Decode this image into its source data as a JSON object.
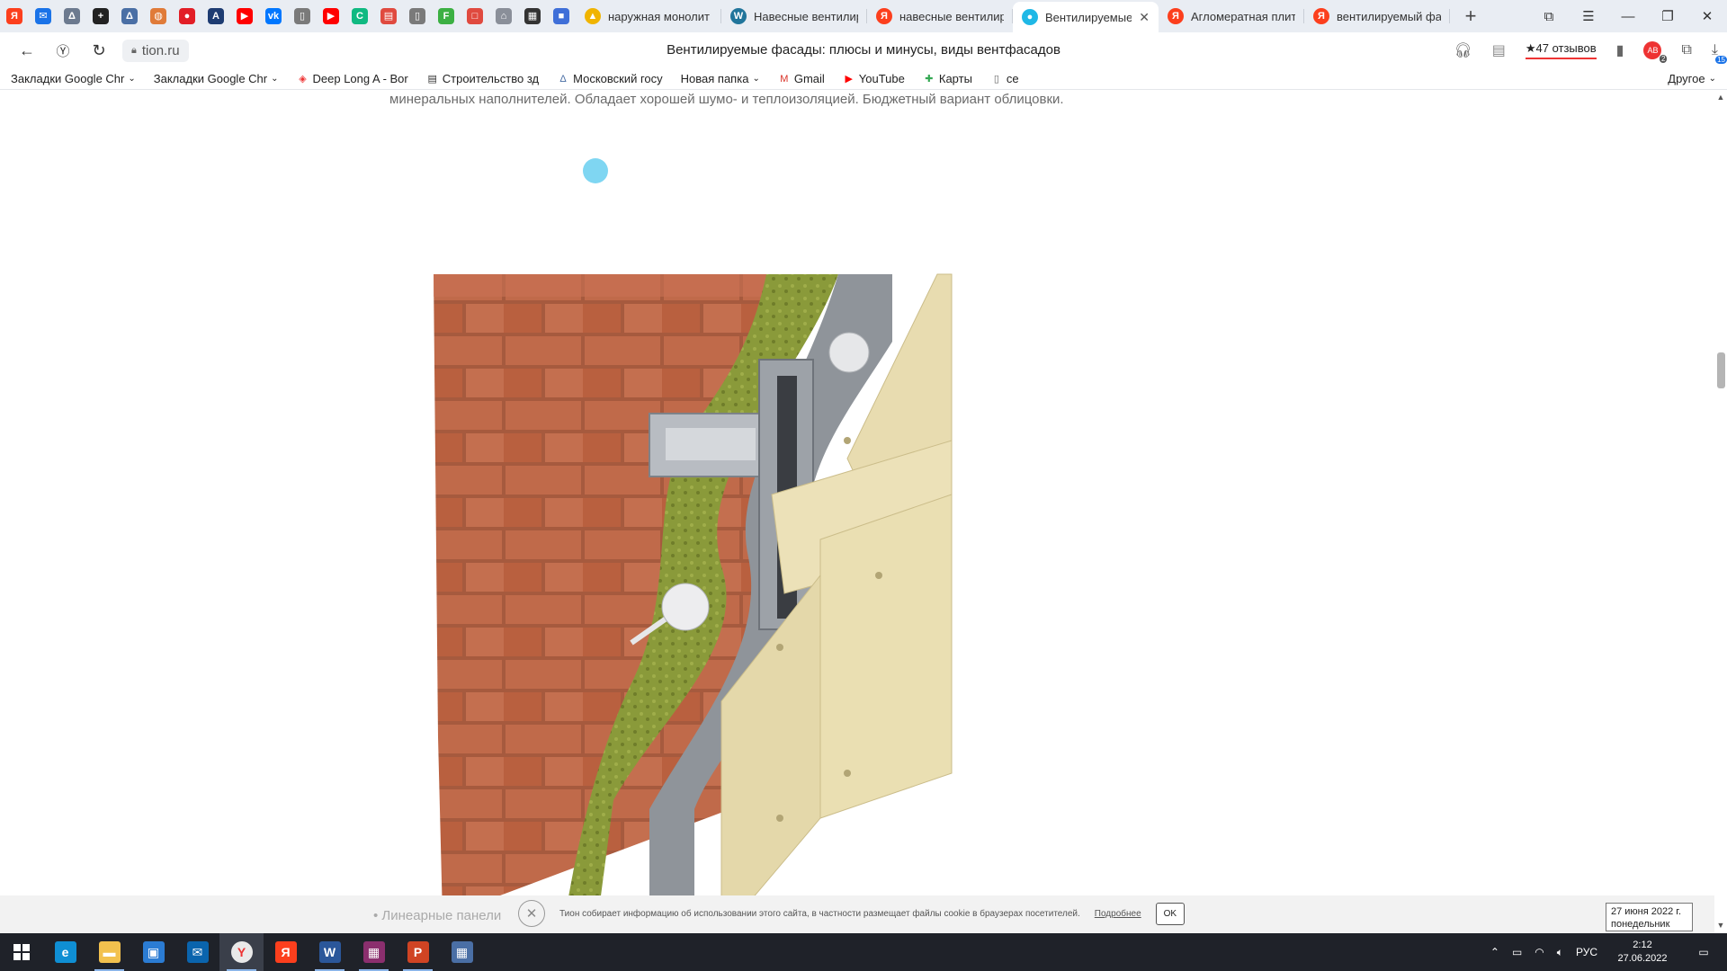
{
  "browser": {
    "pinned_tabs": [
      {
        "icon": "yandex-icon",
        "color": "#fc3f1d",
        "glyph": "Я"
      },
      {
        "icon": "mail-icon",
        "color": "#1a73e8",
        "glyph": "✉"
      },
      {
        "icon": "tower-icon",
        "color": "#6c7a8f",
        "glyph": "Δ"
      },
      {
        "icon": "plus-cross-icon",
        "color": "#222222",
        "glyph": "+"
      },
      {
        "icon": "tower-icon",
        "color": "#4a6fa5",
        "glyph": "Δ"
      },
      {
        "icon": "map-icon",
        "color": "#e07b39",
        "glyph": "◍"
      },
      {
        "icon": "drop-icon",
        "color": "#e21e26",
        "glyph": "●"
      },
      {
        "icon": "letter-a-icon",
        "color": "#1e3c72",
        "glyph": "A"
      },
      {
        "icon": "youtube-icon",
        "color": "#ff0000",
        "glyph": "▶"
      },
      {
        "icon": "vk-icon",
        "color": "#0077ff",
        "glyph": "vk"
      },
      {
        "icon": "document-icon",
        "color": "#7a7a7a",
        "glyph": "▯"
      },
      {
        "icon": "youtube-icon",
        "color": "#ff0000",
        "glyph": "▶"
      },
      {
        "icon": "refresh-green-icon",
        "color": "#10b981",
        "glyph": "C"
      },
      {
        "icon": "pdf-icon",
        "color": "#e04a3f",
        "glyph": "▤"
      },
      {
        "icon": "document-icon",
        "color": "#7a7a7a",
        "glyph": "▯"
      },
      {
        "icon": "letter-f-icon",
        "color": "#3cb043",
        "glyph": "F"
      },
      {
        "icon": "chat-icon",
        "color": "#e04a3f",
        "glyph": "□"
      },
      {
        "icon": "house-icon",
        "color": "#8a8f99",
        "glyph": "⌂"
      },
      {
        "icon": "book-icon",
        "color": "#333333",
        "glyph": "▦"
      },
      {
        "icon": "cube-icon",
        "color": "#3f6fd8",
        "glyph": "■"
      }
    ],
    "tabs": [
      {
        "title": "наружная монолит",
        "icon": "image-icon",
        "color": "#f0b400",
        "glyph": "▲",
        "active": false
      },
      {
        "title": "Навесные вентилир",
        "icon": "wordpress-icon",
        "color": "#21759b",
        "glyph": "W",
        "active": false
      },
      {
        "title": "навесные вентилир",
        "icon": "yandex-icon",
        "color": "#fc3f1d",
        "glyph": "Я",
        "active": false
      },
      {
        "title": "Вентилируемые",
        "icon": "tion-icon",
        "color": "#1fb8e6",
        "glyph": "●",
        "active": true
      },
      {
        "title": "Агломератная плит",
        "icon": "yandex-icon",
        "color": "#fc3f1d",
        "glyph": "Я",
        "active": false
      },
      {
        "title": "вентилируемый фа",
        "icon": "yandex-icon",
        "color": "#fc3f1d",
        "glyph": "Я",
        "active": false
      }
    ],
    "url": "tion.ru",
    "page_title": "Вентилируемые фасады: плюсы и минусы, виды вентфасадов",
    "reviews": "★47 отзывов",
    "extension_badge": "2",
    "downloads_badge": "15"
  },
  "bookmarks": [
    {
      "label": "Закладки Google Chr",
      "icon": "folder-icon",
      "dropdown": true
    },
    {
      "label": "Закладки Google Chr",
      "icon": "folder-icon",
      "dropdown": true
    },
    {
      "label": "Deep Long A - Bor",
      "icon": "deep-long-icon",
      "dropdown": false
    },
    {
      "label": "Строительство зд",
      "icon": "building-icon",
      "dropdown": false
    },
    {
      "label": "Московский госу",
      "icon": "tower-icon",
      "dropdown": false
    },
    {
      "label": "Новая папка",
      "icon": "folder-icon",
      "dropdown": true
    },
    {
      "label": "Gmail",
      "icon": "gmail-icon",
      "dropdown": false
    },
    {
      "label": "YouTube",
      "icon": "youtube-icon",
      "dropdown": false
    },
    {
      "label": "Карты",
      "icon": "maps-icon",
      "dropdown": false
    },
    {
      "label": "се",
      "icon": "document-icon",
      "dropdown": false
    }
  ],
  "bookmarks_other": "Другое",
  "content": {
    "intro_text": "минеральных наполнителей. Обладает хорошей шумо- и теплоизоляцией. Бюджетный вариант облицовки.",
    "list_item": "Линеарные панели",
    "image_alt": "ventilated facade layers"
  },
  "cookie": {
    "text": "Тион собирает информацию об использовании этого сайта, в частности размещает файлы cookie в браузерах посетителей.",
    "link": "Подробнее",
    "ok": "OK"
  },
  "date_tooltip": {
    "line1": "27 июня 2022 г.",
    "line2": "понедельник"
  },
  "taskbar": {
    "apps": [
      {
        "name": "edge",
        "icon": "edge-icon",
        "color": "#0f8fd4",
        "glyph": "e",
        "open": false,
        "active": false
      },
      {
        "name": "explorer",
        "icon": "folder-icon",
        "color": "#f2c14e",
        "glyph": "▬",
        "open": true,
        "active": false
      },
      {
        "name": "store",
        "icon": "store-icon",
        "color": "#2b7cd3",
        "glyph": "▣",
        "open": false,
        "active": false
      },
      {
        "name": "mail",
        "icon": "mail-icon",
        "color": "#0a64ad",
        "glyph": "✉",
        "open": false,
        "active": false
      },
      {
        "name": "yandex-browser",
        "icon": "yandex-browser-icon",
        "color": "#e9e9e9",
        "glyph": "Y",
        "open": true,
        "active": true
      },
      {
        "name": "yandex",
        "icon": "yandex-icon",
        "color": "#fc3f1d",
        "glyph": "Я",
        "open": false,
        "active": false
      },
      {
        "name": "word",
        "icon": "word-icon",
        "color": "#2b579a",
        "glyph": "W",
        "open": true,
        "active": false
      },
      {
        "name": "winrar",
        "icon": "winrar-icon",
        "color": "#8b2f6e",
        "glyph": "▦",
        "open": true,
        "active": false
      },
      {
        "name": "powerpoint",
        "icon": "powerpoint-icon",
        "color": "#d04423",
        "glyph": "P",
        "open": true,
        "active": false
      },
      {
        "name": "calculator",
        "icon": "calculator-icon",
        "color": "#4a6fa5",
        "glyph": "▦",
        "open": false,
        "active": false
      }
    ],
    "lang": "РУС",
    "time": "2:12",
    "date": "27.06.2022"
  }
}
